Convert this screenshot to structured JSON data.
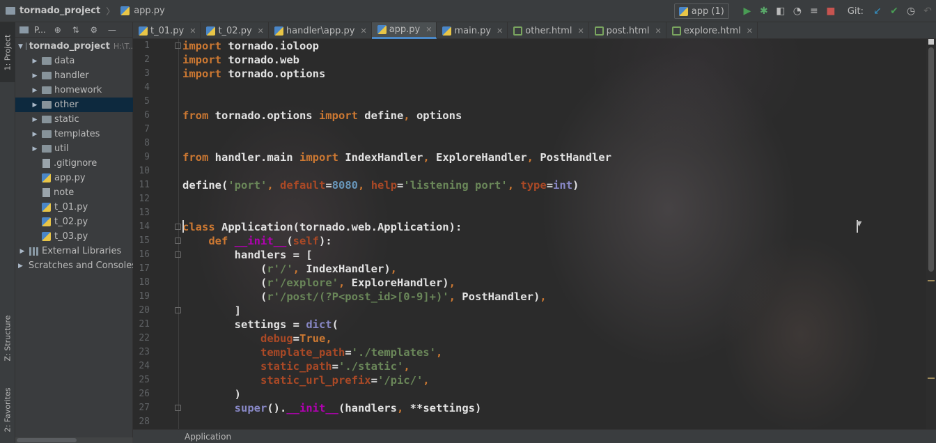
{
  "navbar": {
    "project": "tornado_project",
    "file": "app.py",
    "run_config": "app (1)",
    "git_label": "Git:",
    "icons": [
      "run-icon",
      "debug-icon",
      "coverage-icon",
      "profile-icon",
      "build-icon",
      "stop-icon",
      "vcs-update-icon",
      "vcs-commit-icon",
      "history-icon",
      "revert-icon"
    ]
  },
  "leftstrip": {
    "project_tab": "1: Project",
    "structure_tab": "Z: Structure",
    "favorites_tab": "2: Favorites"
  },
  "project_panel": {
    "header_label": "P...",
    "root": "tornado_project",
    "root_path": "H:\\T..",
    "items": [
      {
        "label": "data",
        "type": "dir"
      },
      {
        "label": "handler",
        "type": "dir"
      },
      {
        "label": "homework",
        "type": "dir"
      },
      {
        "label": "other",
        "type": "dir"
      },
      {
        "label": "static",
        "type": "dir"
      },
      {
        "label": "templates",
        "type": "dir"
      },
      {
        "label": "util",
        "type": "dir"
      },
      {
        "label": ".gitignore",
        "type": "file"
      },
      {
        "label": "app.py",
        "type": "py"
      },
      {
        "label": "note",
        "type": "file"
      },
      {
        "label": "t_01.py",
        "type": "py"
      },
      {
        "label": "t_02.py",
        "type": "py"
      },
      {
        "label": "t_03.py",
        "type": "py"
      }
    ],
    "external_libraries": "External Libraries",
    "scratches": "Scratches and Consoles"
  },
  "tabs": [
    {
      "label": "t_01.py",
      "type": "py"
    },
    {
      "label": "t_02.py",
      "type": "py"
    },
    {
      "label": "handler\\app.py",
      "type": "py"
    },
    {
      "label": "app.py",
      "type": "py",
      "active": true
    },
    {
      "label": "main.py",
      "type": "py"
    },
    {
      "label": "other.html",
      "type": "html"
    },
    {
      "label": "post.html",
      "type": "html"
    },
    {
      "label": "explore.html",
      "type": "html"
    }
  ],
  "line_numbers": [
    "1",
    "2",
    "3",
    "4",
    "5",
    "6",
    "7",
    "8",
    "9",
    "10",
    "11",
    "12",
    "13",
    "14",
    "15",
    "16",
    "17",
    "18",
    "19",
    "20",
    "21",
    "22",
    "23",
    "24",
    "25",
    "26",
    "27",
    "28"
  ],
  "code_lines": [
    "import tornado.ioloop",
    "import tornado.web",
    "import tornado.options",
    "",
    "",
    "from tornado.options import define, options",
    "",
    "",
    "from handler.main import IndexHandler, ExploreHandler, PostHandler",
    "",
    "define('port', default=8080, help='listening port', type=int)",
    "",
    "",
    "class Application(tornado.web.Application):",
    "    def __init__(self):",
    "        handlers = [",
    "            (r'/', IndexHandler),",
    "            (r'/explore', ExploreHandler),",
    "            (r'/post/(?P<post_id>[0-9]+)', PostHandler),",
    "        ]",
    "        settings = dict(",
    "            debug=True,",
    "            template_path='./templates',",
    "            static_path='./static',",
    "            static_url_prefix='/pic/',",
    "        )",
    "        super().__init__(handlers, **settings)",
    ""
  ],
  "status_breadcrumb": "Application"
}
